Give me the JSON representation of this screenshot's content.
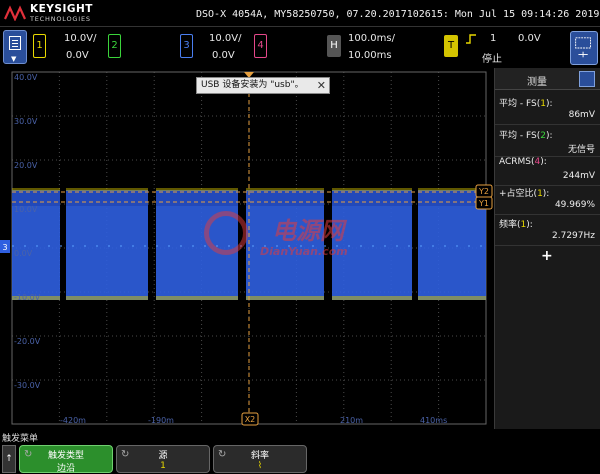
{
  "brand": {
    "name": "KEYSIGHT",
    "sub": "TECHNOLOGIES"
  },
  "header": {
    "info": "DSO-X 4054A, MY58250750, 07.20.2017102615: Mon Jul 15 09:14:26 2019"
  },
  "channels": [
    {
      "id": "1",
      "scale": "10.0V/",
      "offset": "0.0V",
      "color": "#e8d800"
    },
    {
      "id": "2",
      "scale": "",
      "offset": "",
      "color": "#3bd43b"
    },
    {
      "id": "3",
      "scale": "10.0V/",
      "offset": "0.0V",
      "color": "#4a7ef0"
    },
    {
      "id": "4",
      "scale": "",
      "offset": "",
      "color": "#e5488a"
    }
  ],
  "horizontal": {
    "label": "H",
    "timebase": "100.0ms/",
    "delay": "10.00ms"
  },
  "trigger": {
    "label": "T",
    "channel": "1",
    "level": "0.0V",
    "status": "停止"
  },
  "toast": {
    "text": "USB 设备安装为 \"usb\"。",
    "close": "✕"
  },
  "scope": {
    "y_labels": [
      "40.0V",
      "30.0V",
      "20.0V",
      "10.0V",
      "0.0V",
      "-10.0V",
      "-20.0V",
      "-30.0V"
    ],
    "x_labels": [
      "-420m",
      "-190m",
      "",
      "210m",
      "410ms"
    ],
    "markers": {
      "y2": "Y2",
      "y1": "Y1",
      "x2": "X2",
      "ch3": "3"
    },
    "trace_color": "#2f5fe0",
    "trace_color_dark": "#2148b8"
  },
  "measurements": {
    "title": "测量",
    "items": [
      {
        "label": "平均 - FS",
        "ch": "1",
        "value": "86mV",
        "color": "c1"
      },
      {
        "label": "平均 - FS",
        "ch": "2",
        "value": "无信号",
        "color": "c2"
      },
      {
        "label": "ACRMS",
        "ch": "4",
        "value": "244mV",
        "color": "c4"
      },
      {
        "label": "+占空比",
        "ch": "1",
        "value": "49.969%",
        "color": "c1"
      },
      {
        "label": "频率",
        "ch": "1",
        "value": "2.7297Hz",
        "color": "c1"
      }
    ],
    "add": "+"
  },
  "menu": {
    "title": "触发菜单",
    "back": "↑",
    "softkeys": [
      {
        "label": "触发类型",
        "value": "边沿",
        "active": true
      },
      {
        "label": "源",
        "value": "1",
        "active": false
      },
      {
        "label": "斜率",
        "value": "⌇",
        "active": false
      }
    ]
  },
  "watermark": {
    "main": "电源网",
    "sub": "DianYuan.com"
  }
}
